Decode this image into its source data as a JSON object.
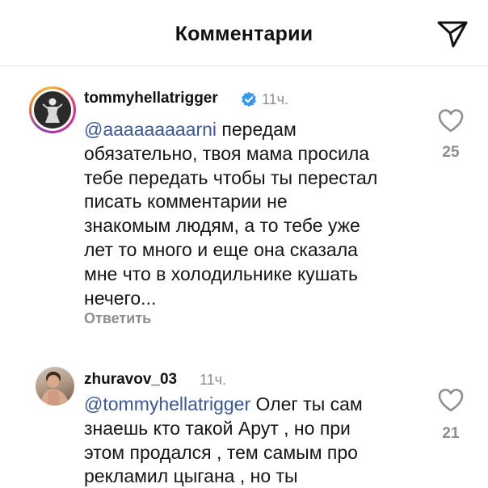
{
  "header": {
    "title": "Комментарии"
  },
  "comments": [
    {
      "username": "tommyhellatrigger",
      "verified": true,
      "time": "11ч.",
      "mention": "@aaaaaaaaarni",
      "lines": [
        " передам",
        "обязательно, твоя мама просила",
        "тебе передать чтобы ты перестал",
        "писать комментарии не",
        "знакомым людям, а то тебе уже",
        "лет то много и еще она сказала",
        "мне что в холодильнике кушать",
        "нечего..."
      ],
      "reply_label": "Ответить",
      "likes": "25"
    },
    {
      "username": "zhuravov_03",
      "verified": false,
      "time": "11ч.",
      "mention": "@tommyhellatrigger",
      "lines": [
        " Олег ты сам",
        "знаешь кто такой Арут , но при",
        "этом продался , тем самым про",
        "рекламил цыгана , но ты"
      ],
      "likes": "21"
    }
  ],
  "icons": {
    "send": "send-icon",
    "heart": "heart-outline-icon",
    "verified": "verified-badge-icon"
  },
  "colors": {
    "mention": "#385898",
    "secondary_text": "#8e8e8e",
    "verified": "#3897f0"
  }
}
